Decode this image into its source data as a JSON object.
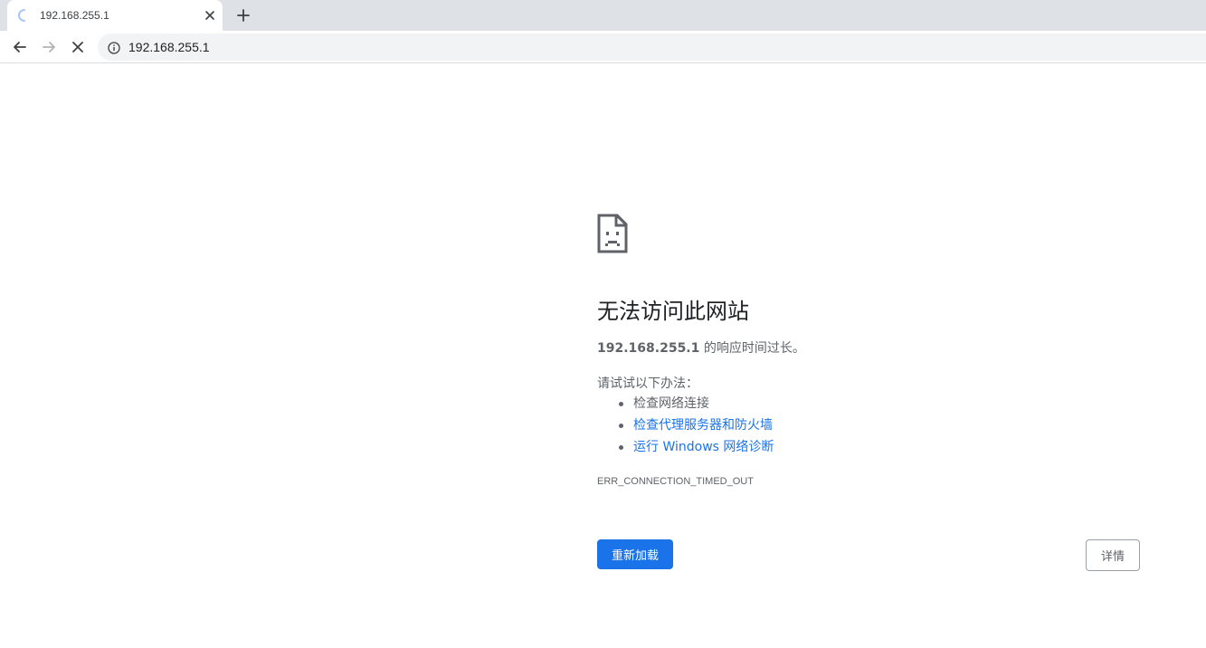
{
  "browser": {
    "tab": {
      "title": "192.168.255.1",
      "loading": true
    },
    "address_bar": {
      "url": "192.168.255.1"
    },
    "icons": {
      "back": "arrow-left",
      "forward": "arrow-right",
      "stop": "close-x",
      "new_tab": "plus",
      "tab_close": "close-x",
      "site_info": "info-circle"
    }
  },
  "error_page": {
    "icon": "sad-document",
    "heading": "无法访问此网站",
    "host": "192.168.255.1",
    "summary_suffix": " 的响应时间过长。",
    "suggestions_label": "请试试以下办法：",
    "suggestions": [
      {
        "text": "检查网络连接",
        "is_link": false
      },
      {
        "text": "检查代理服务器和防火墙",
        "is_link": true
      },
      {
        "text": "运行 Windows 网络诊断",
        "is_link": true
      }
    ],
    "error_code": "ERR_CONNECTION_TIMED_OUT",
    "reload_label": "重新加载",
    "details_label": "详情"
  },
  "colors": {
    "accent": "#1a73e8",
    "tabstrip_bg": "#dee1e6",
    "omnibox_bg": "#f1f3f4",
    "secondary_text": "#5f6368"
  }
}
